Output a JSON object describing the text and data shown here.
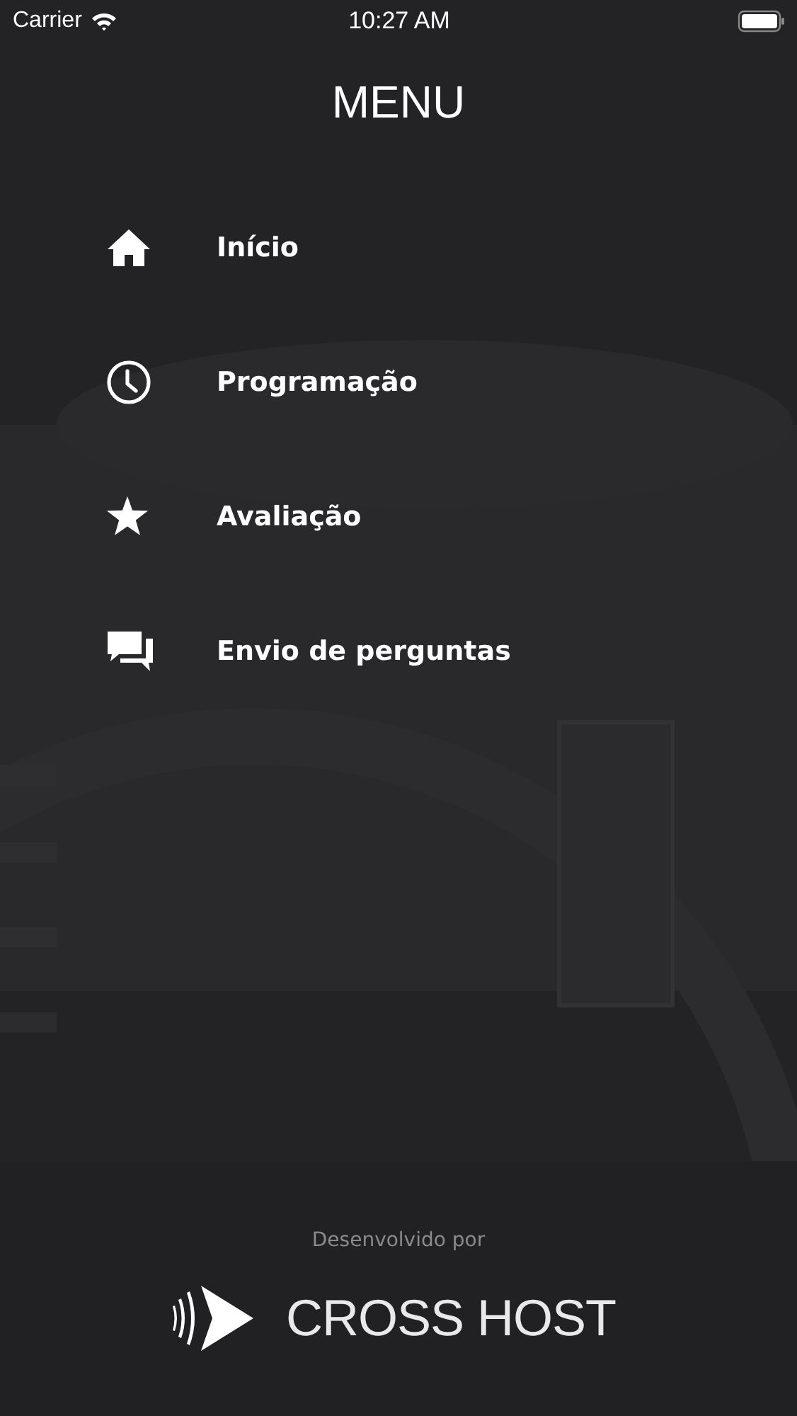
{
  "status_bar": {
    "carrier": "Carrier",
    "time": "10:27 AM"
  },
  "title": "MENU",
  "menu": [
    {
      "kind": "home",
      "label": "Início"
    },
    {
      "kind": "clock",
      "label": "Programação"
    },
    {
      "kind": "star",
      "label": "Avaliação"
    },
    {
      "kind": "chat",
      "label": "Envio de perguntas"
    }
  ],
  "footer": {
    "caption": "Desenvolvido por",
    "logo_text": "CROSS HOST"
  }
}
